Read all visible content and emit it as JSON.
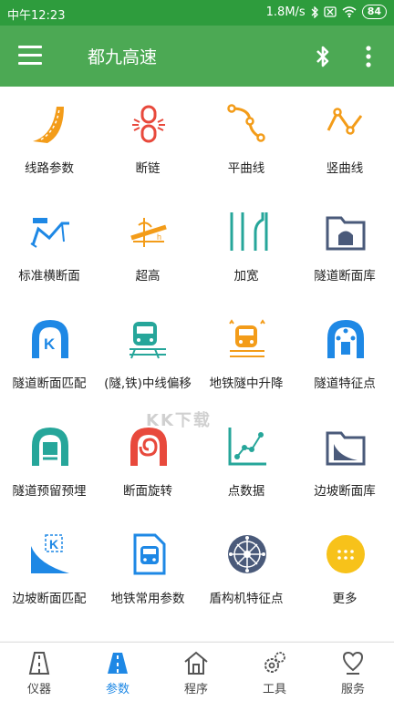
{
  "status": {
    "time": "中午12:23",
    "speed": "1.8M/s",
    "battery": "84"
  },
  "appbar": {
    "title": "都九高速"
  },
  "colors": {
    "statusbar": "#2e9c3d",
    "appbar": "#4ca954",
    "orange": "#f39c19",
    "red": "#e8493c",
    "teal": "#26a69a",
    "blue": "#1e88e5",
    "slate": "#4a5a7a",
    "tab_active": "#1e88e5"
  },
  "grid": [
    {
      "label": "线路参数",
      "icon": "road-curve-icon"
    },
    {
      "label": "断链",
      "icon": "broken-chain-icon"
    },
    {
      "label": "平曲线",
      "icon": "horizontal-curve-icon"
    },
    {
      "label": "竖曲线",
      "icon": "vertical-curve-icon"
    },
    {
      "label": "标准横断面",
      "icon": "cross-section-icon"
    },
    {
      "label": "超高",
      "icon": "superelevation-icon"
    },
    {
      "label": "加宽",
      "icon": "widening-icon"
    },
    {
      "label": "隧道断面库",
      "icon": "tunnel-folder-icon"
    },
    {
      "label": "隧道断面匹配",
      "icon": "tunnel-match-icon"
    },
    {
      "label": "(隧,铁)中线偏移",
      "icon": "train-offset-icon"
    },
    {
      "label": "地铁隧中升降",
      "icon": "metro-lift-icon"
    },
    {
      "label": "隧道特征点",
      "icon": "tunnel-feature-icon"
    },
    {
      "label": "隧道预留预埋",
      "icon": "tunnel-reserve-icon"
    },
    {
      "label": "断面旋转",
      "icon": "section-rotate-icon"
    },
    {
      "label": "点数据",
      "icon": "point-data-icon"
    },
    {
      "label": "边坡断面库",
      "icon": "slope-folder-icon"
    },
    {
      "label": "边坡断面匹配",
      "icon": "slope-match-icon"
    },
    {
      "label": "地铁常用参数",
      "icon": "metro-doc-icon"
    },
    {
      "label": "盾构机特征点",
      "icon": "shield-machine-icon"
    },
    {
      "label": "更多",
      "icon": "more-dots-icon"
    }
  ],
  "tabs": [
    {
      "label": "仪器",
      "icon": "instrument-icon"
    },
    {
      "label": "参数",
      "icon": "params-icon",
      "active": true
    },
    {
      "label": "程序",
      "icon": "home-program-icon"
    },
    {
      "label": "工具",
      "icon": "tools-gear-icon"
    },
    {
      "label": "服务",
      "icon": "service-heart-icon"
    }
  ],
  "watermark": "KK下载"
}
